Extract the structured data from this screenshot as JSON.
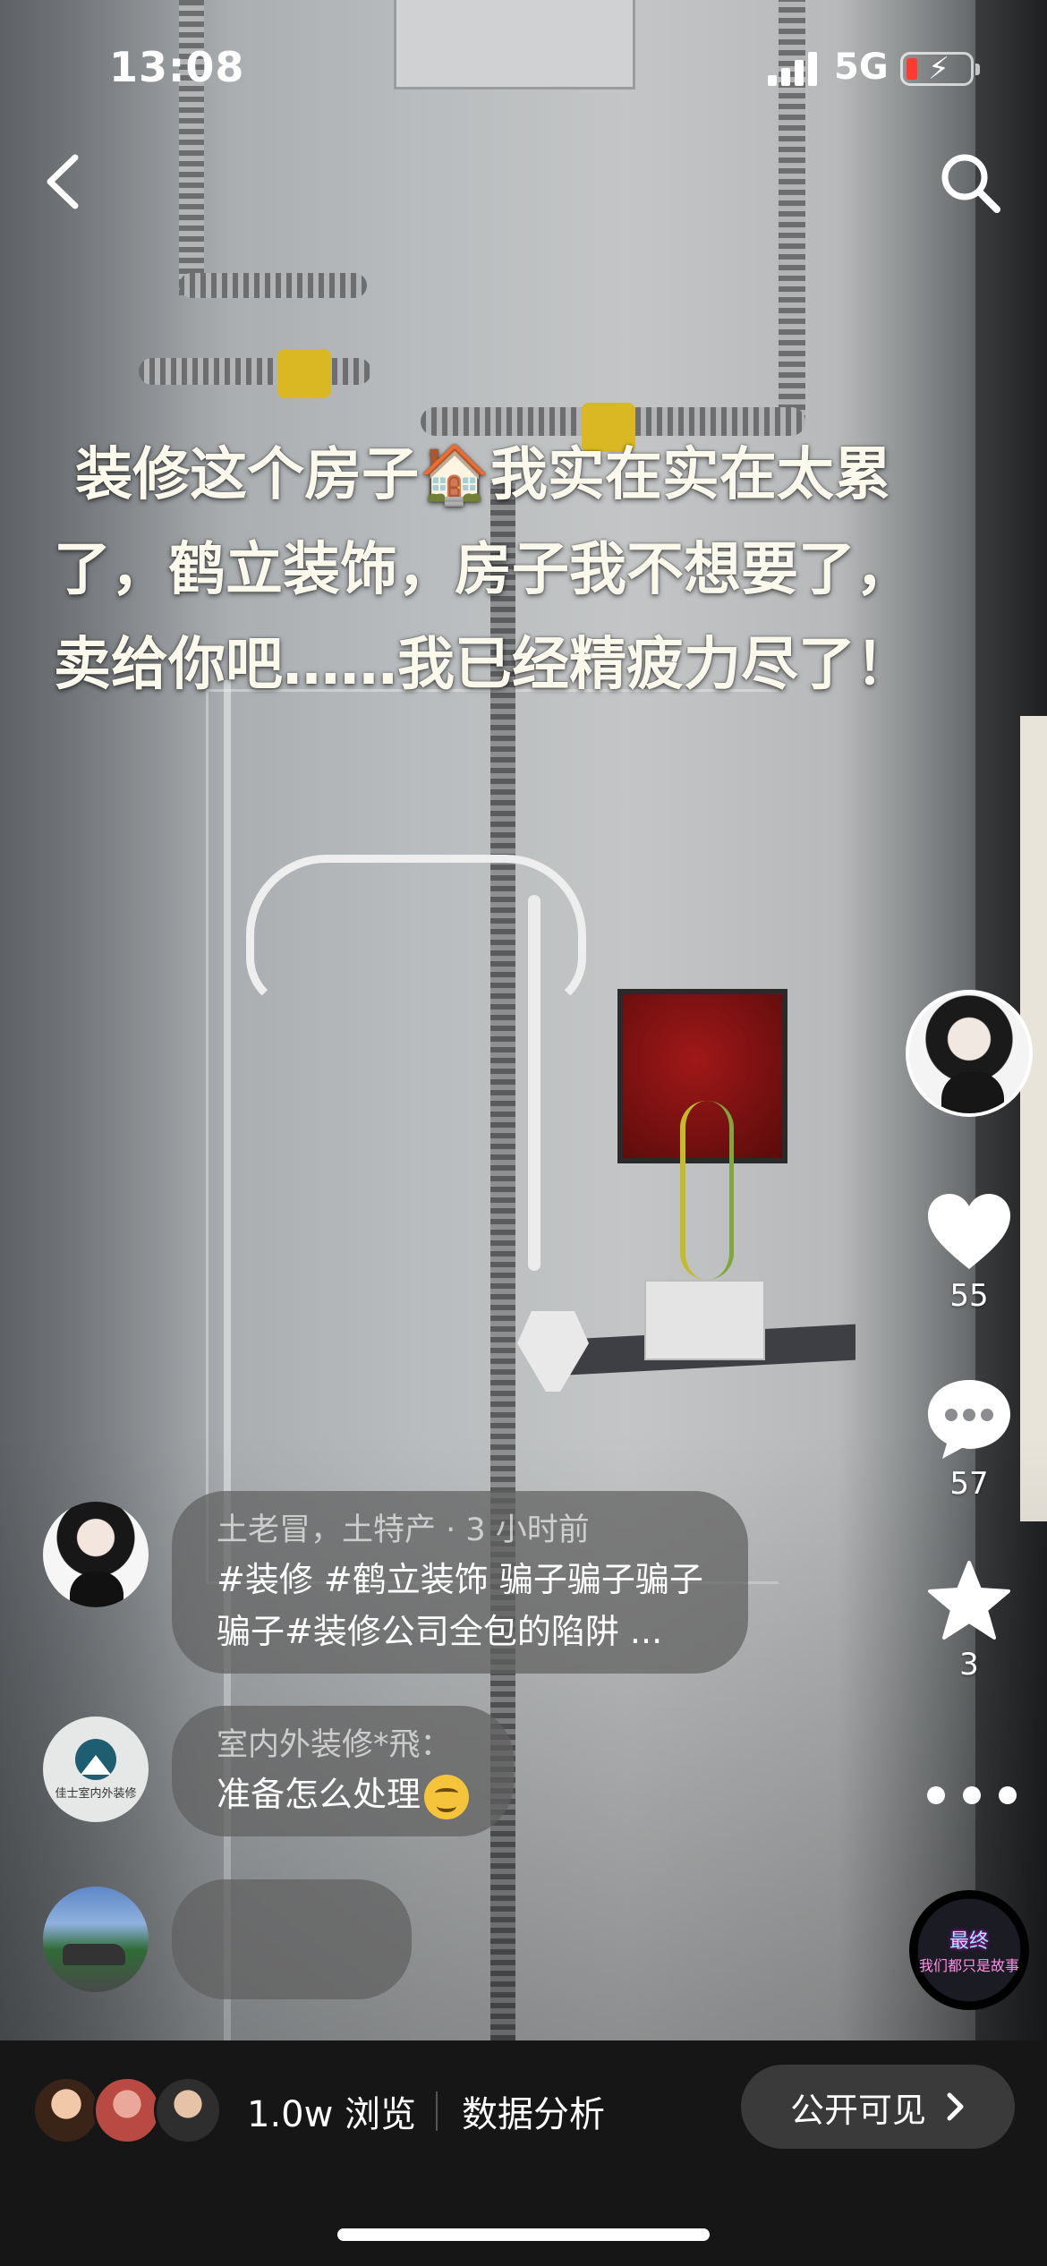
{
  "status_bar": {
    "time": "13:08",
    "network": "5G"
  },
  "caption": "装修这个房子🏠我实在实在太累了，鹤立装饰，房子我不想要了，卖给你吧……我已经精疲力尽了！",
  "rail": {
    "likes": "55",
    "comments": "57",
    "favorites": "3"
  },
  "music": {
    "line1": "最终",
    "line2": "我们都只是故事"
  },
  "comments": [
    {
      "meta": "土老冒，土特产 · 3 小时前",
      "text_line1": "#装修 #鹤立装饰 骗子骗子骗子",
      "text_line2": "骗子#装修公司全包的陷阱 ..."
    },
    {
      "meta": "室内外装修*飛：",
      "text": "准备怎么处理"
    }
  ],
  "avatar_logo_text": "佳士室内外装修",
  "bottom_bar": {
    "views": "1.0w 浏览",
    "analysis": "数据分析",
    "visibility": "公开可见"
  },
  "icons": {
    "back": "chevron-left-icon",
    "search": "search-icon",
    "like": "heart-icon",
    "comment": "comment-bubble-icon",
    "favorite": "star-icon",
    "more": "more-dots-icon",
    "visibility_arrow": "chevron-right-icon"
  },
  "colors": {
    "battery_low": "#ff3b30",
    "caption_text": "#fbf8ec",
    "bottom_bar_bg": "#161616"
  }
}
